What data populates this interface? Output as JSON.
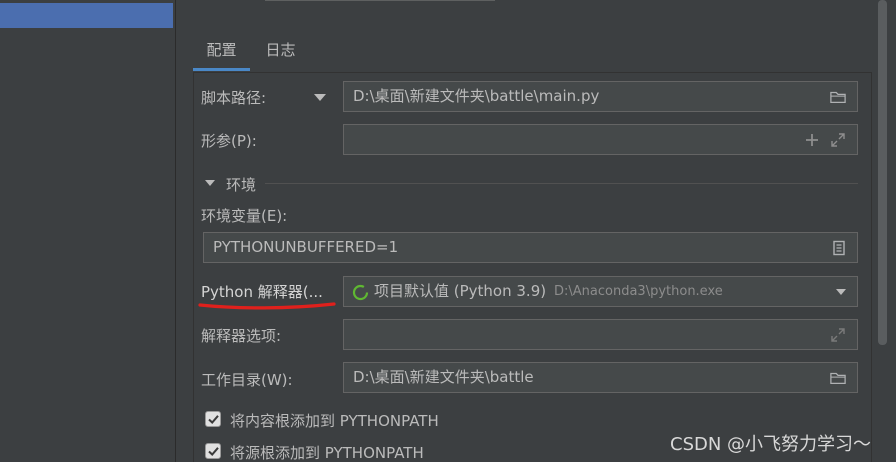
{
  "tabs": {
    "config": "配置",
    "log": "日志"
  },
  "script": {
    "label": "脚本路径:",
    "value": "D:\\桌面\\新建文件夹\\battle\\main.py"
  },
  "params": {
    "label": "形参(P):",
    "value": ""
  },
  "env_section": {
    "label": "环境"
  },
  "env_vars": {
    "label": "环境变量(E):",
    "value": "PYTHONUNBUFFERED=1"
  },
  "interpreter": {
    "label": "Python 解释器(...",
    "value": "项目默认值 (Python 3.9)",
    "path": "D:\\Anaconda3\\python.exe"
  },
  "interp_options": {
    "label": "解释器选项:",
    "value": ""
  },
  "workdir": {
    "label": "工作目录(W):",
    "value": "D:\\桌面\\新建文件夹\\battle"
  },
  "checkboxes": [
    {
      "label": "将内容根添加到 PYTHONPATH",
      "checked": true
    },
    {
      "label": "将源根添加到 PYTHONPATH",
      "checked": true
    }
  ],
  "watermark": "CSDN @小飞努力学习～",
  "colors": {
    "accent": "#4a88c7",
    "selection": "#4b6eaf",
    "annotation": "#e0201c"
  }
}
